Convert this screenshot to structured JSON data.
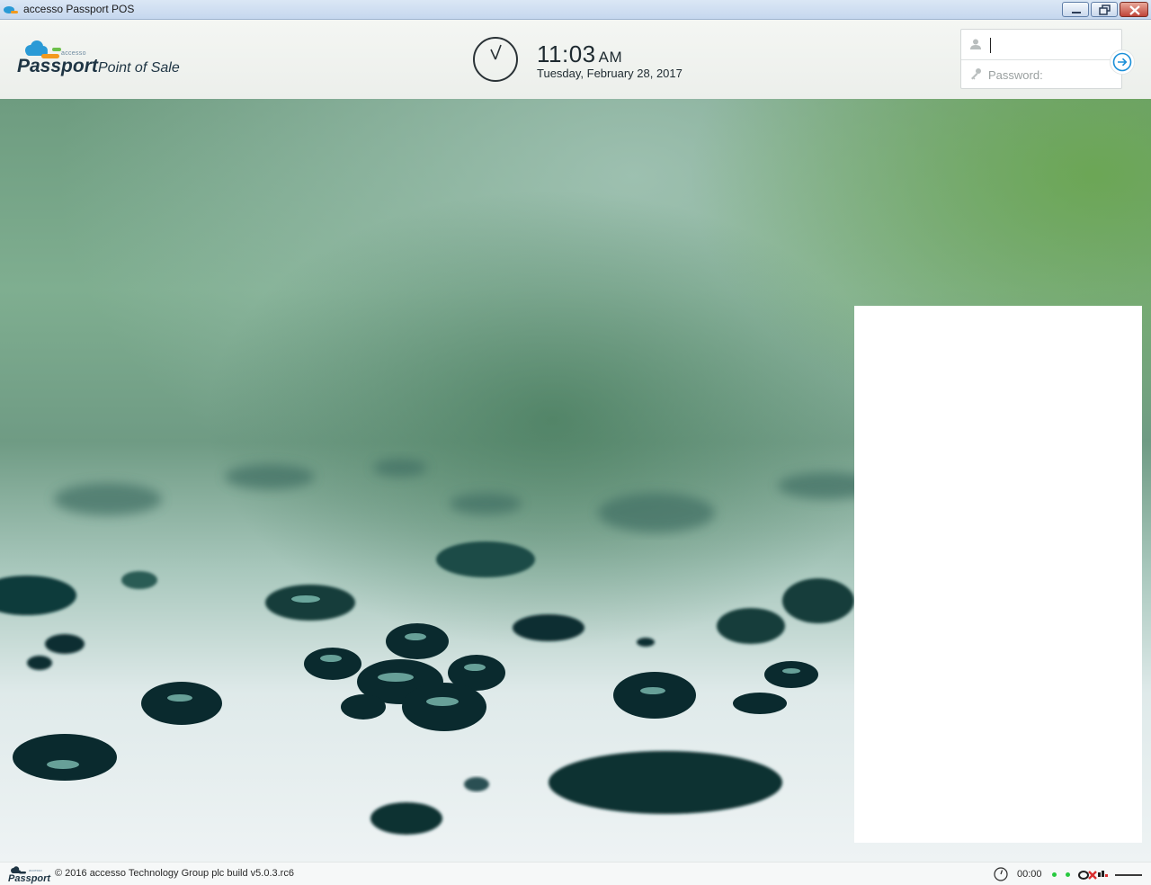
{
  "window": {
    "title": "accesso Passport POS",
    "controls": [
      "minimize",
      "restore",
      "close"
    ]
  },
  "header": {
    "brand_small": "accesso",
    "brand_name": "Passport",
    "brand_subtitle": "Point of Sale",
    "time": "11:03",
    "ampm": "AM",
    "date": "Tuesday, February 28, 2017"
  },
  "login": {
    "username_value": "",
    "password_placeholder": "Password:",
    "user_icon": "user-icon",
    "key_icon": "key-icon",
    "submit_icon": "arrow-right-circle-icon"
  },
  "footer": {
    "brand_small": "accesso",
    "brand_name": "Passport",
    "copyright": "© 2016 accesso Technology Group plc build v5.0.3.rc6",
    "timer": "00:00",
    "status_dots": [
      "online",
      "online"
    ],
    "status_color": "#27c93f"
  },
  "colors": {
    "accent": "#1a8fd8",
    "brand_dark": "#1f3544",
    "cloud_blue": "#2a9ad6",
    "cloud_orange": "#f39a1e",
    "cloud_green": "#6cc04a"
  }
}
